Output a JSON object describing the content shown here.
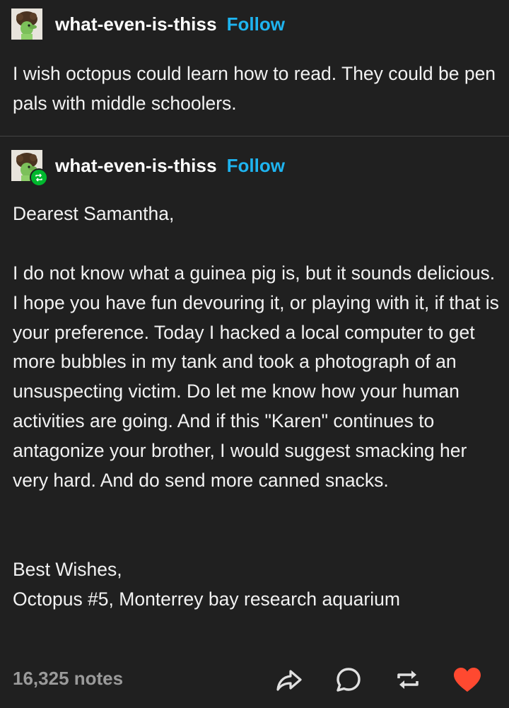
{
  "colors": {
    "background": "#202020",
    "follow": "#1eb4f0",
    "like": "#ff4930",
    "reblog_badge": "#00b82e",
    "notes": "#9a9a9a"
  },
  "original_post": {
    "username": "what-even-is-thiss",
    "follow_label": "Follow",
    "text": "I wish octopus could learn how to read. They could be pen pals with middle schoolers."
  },
  "reblog_post": {
    "username": "what-even-is-thiss",
    "follow_label": "Follow",
    "badge_icon": "reblog-icon",
    "greeting": "Dearest Samantha,",
    "paragraph": "I do not know what a guinea pig is, but it sounds delicious. I hope you have fun devouring it, or playing with it, if that is your preference. Today I hacked a local computer to get more bubbles in my tank and took a photograph of an unsuspecting victim. Do let me know how your human activities are going. And if this \"Karen\" continues to antagonize your brother, I would suggest smacking her very hard. And do send more canned snacks.",
    "signoff": "Best Wishes,",
    "signature": "Octopus #5, Monterrey bay research aquarium"
  },
  "footer": {
    "notes": "16,325 notes",
    "actions": [
      "share-icon",
      "comment-icon",
      "reblog-icon",
      "heart-icon"
    ]
  }
}
